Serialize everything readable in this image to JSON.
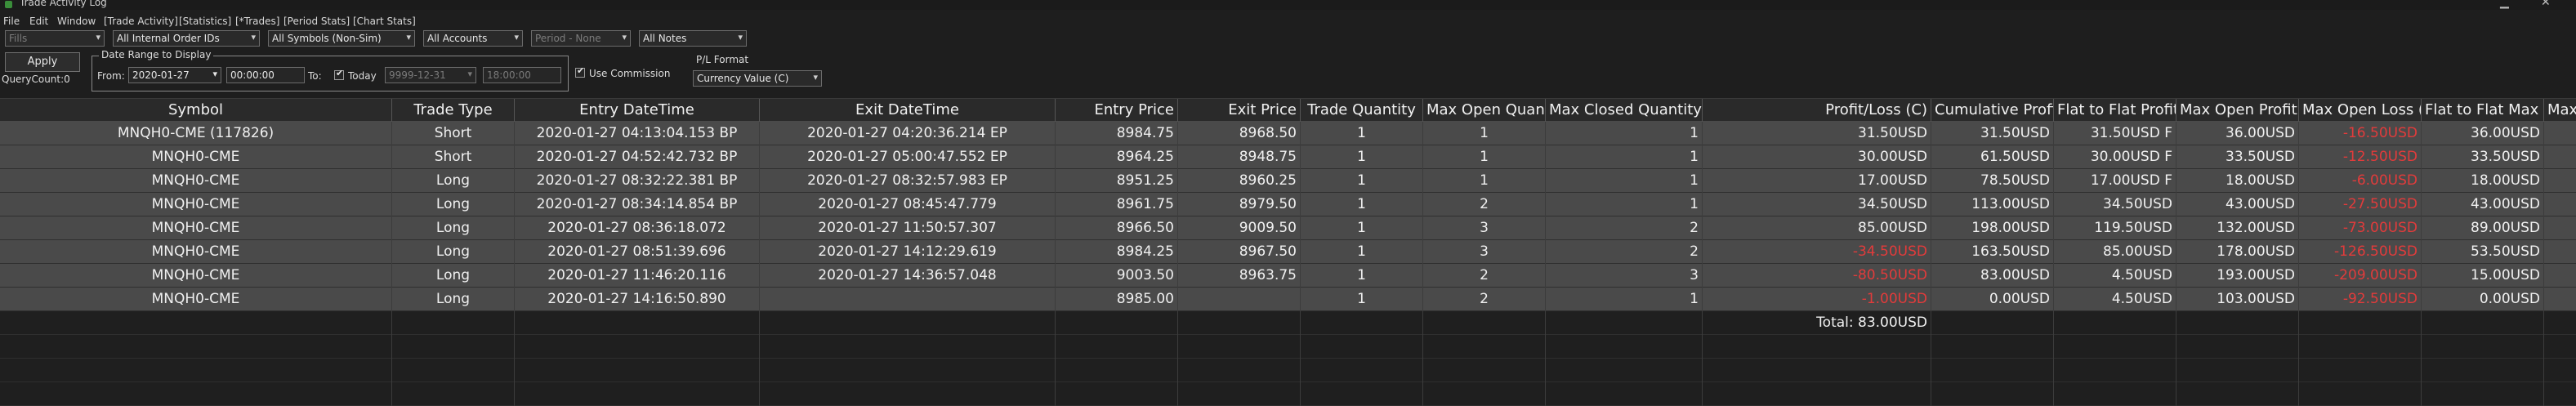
{
  "window": {
    "title": "Trade Activity Log"
  },
  "menu": [
    "File",
    "Edit",
    "Window",
    "[Trade Activity]",
    "[Statistics]",
    "[*Trades]",
    "[Period Stats]",
    "[Chart Stats]"
  ],
  "filters": {
    "fills": "Fills",
    "order_ids": "All Internal Order IDs",
    "symbols": "All Symbols (Non-Sim)",
    "accounts": "All Accounts",
    "period": "Period - None",
    "notes": "All Notes"
  },
  "apply_label": "Apply",
  "query_count": "QueryCount:0",
  "date_range": {
    "legend": "Date Range to Display",
    "from_label": "From:",
    "from_date": "2020-01-27",
    "from_time": "00:00:00",
    "to_label": "To:",
    "today_label": "Today",
    "to_date": "9999-12-31",
    "to_time": "18:00:00"
  },
  "use_commission_label": "Use Commission",
  "pl_format": {
    "label": "P/L Format",
    "value": "Currency Value (C)"
  },
  "columns": [
    "Symbol",
    "Trade Type",
    "Entry DateTime",
    "Exit DateTime",
    "Entry Price",
    "Exit Price",
    "Trade Quantity",
    "Max Open Quantity",
    "Max Closed Quantity",
    "Profit/Loss (C)",
    "Cumulative Profit/Loss (C)",
    "Flat to Flat Profit/Loss (C)",
    "Max Open Profit (C)",
    "Max Open Loss (C)",
    "Flat to Flat Max Open Profit (C)",
    "Max Open Loss (C)"
  ],
  "rows": [
    [
      "MNQH0-CME (117826)",
      "Short",
      "2020-01-27  04:13:04.153 BP",
      "2020-01-27  04:20:36.214 EP",
      "8984.75",
      "8968.50",
      "1",
      "1",
      "1",
      "31.50USD",
      "31.50USD",
      "31.50USD F",
      "36.00USD",
      "-16.50USD",
      "36.00USD"
    ],
    [
      "MNQH0-CME",
      "Short",
      "2020-01-27  04:52:42.732 BP",
      "2020-01-27  05:00:47.552 EP",
      "8964.25",
      "8948.75",
      "1",
      "1",
      "1",
      "30.00USD",
      "61.50USD",
      "30.00USD F",
      "33.50USD",
      "-12.50USD",
      "33.50USD"
    ],
    [
      "MNQH0-CME",
      "Long",
      "2020-01-27  08:32:22.381 BP",
      "2020-01-27  08:32:57.983 EP",
      "8951.25",
      "8960.25",
      "1",
      "1",
      "1",
      "17.00USD",
      "78.50USD",
      "17.00USD F",
      "18.00USD",
      "-6.00USD",
      "18.00USD"
    ],
    [
      "MNQH0-CME",
      "Long",
      "2020-01-27  08:34:14.854 BP",
      "2020-01-27  08:45:47.779",
      "8961.75",
      "8979.50",
      "1",
      "2",
      "1",
      "34.50USD",
      "113.00USD",
      "34.50USD",
      "43.00USD",
      "-27.50USD",
      "43.00USD"
    ],
    [
      "MNQH0-CME",
      "Long",
      "2020-01-27  08:36:18.072",
      "2020-01-27  11:50:57.307",
      "8966.50",
      "9009.50",
      "1",
      "3",
      "2",
      "85.00USD",
      "198.00USD",
      "119.50USD",
      "132.00USD",
      "-73.00USD",
      "89.00USD"
    ],
    [
      "MNQH0-CME",
      "Long",
      "2020-01-27  08:51:39.696",
      "2020-01-27  14:12:29.619",
      "8984.25",
      "8967.50",
      "1",
      "3",
      "2",
      "-34.50USD",
      "163.50USD",
      "85.00USD",
      "178.00USD",
      "-126.50USD",
      "53.50USD"
    ],
    [
      "MNQH0-CME",
      "Long",
      "2020-01-27  11:46:20.116",
      "2020-01-27  14:36:57.048",
      "9003.50",
      "8963.75",
      "1",
      "2",
      "3",
      "-80.50USD",
      "83.00USD",
      "4.50USD",
      "193.00USD",
      "-209.00USD",
      "15.00USD"
    ],
    [
      "MNQH0-CME",
      "Long",
      "2020-01-27  14:16:50.890",
      "",
      "8985.00",
      "",
      "1",
      "2",
      "1",
      "-1.00USD",
      "0.00USD",
      "4.50USD",
      "103.00USD",
      "-92.50USD",
      "0.00USD"
    ]
  ],
  "total_label": "Total: 83.00USD",
  "colors": {
    "negative": "#e23b3b",
    "row_bg": "#4a4a4a",
    "header_bg": "#2a2a2a",
    "bg": "#1e1e1e"
  }
}
